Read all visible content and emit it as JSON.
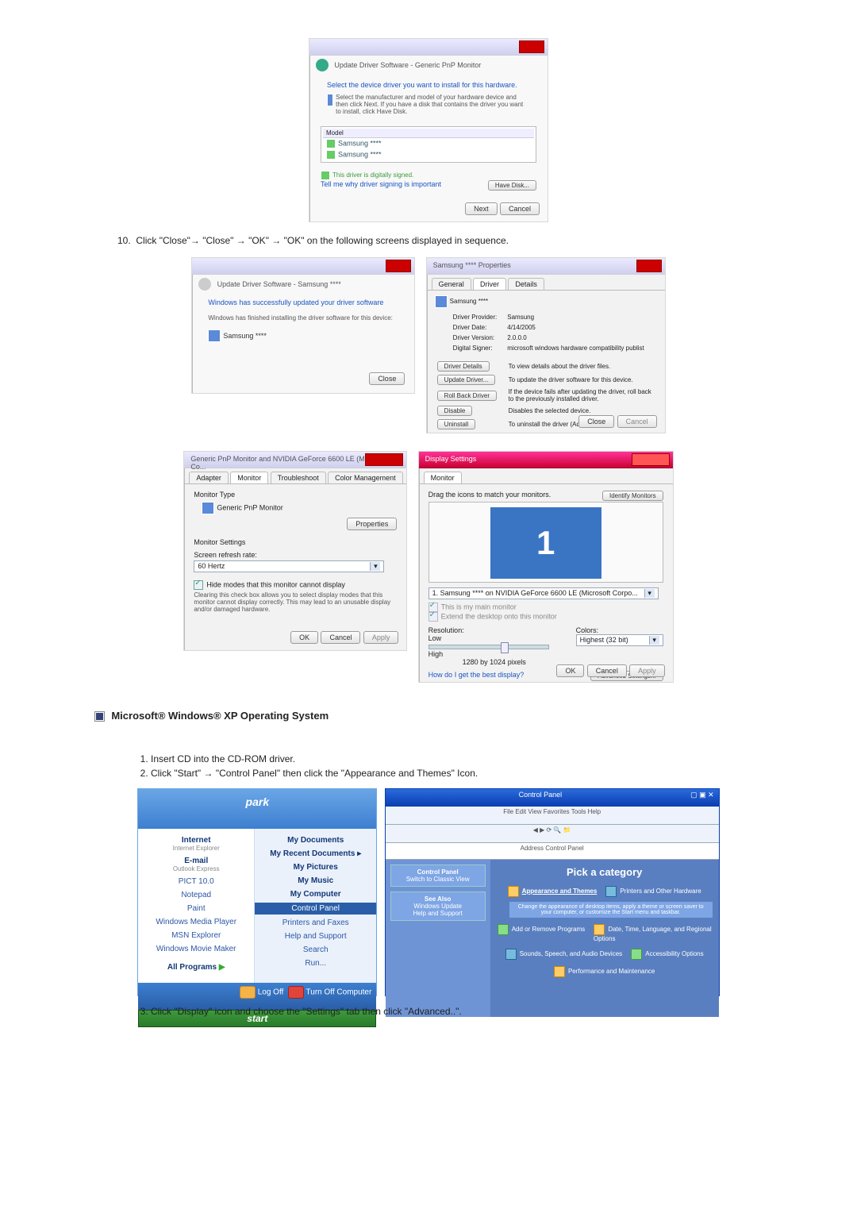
{
  "fig1": {
    "breadcrumb": "Update Driver Software - Generic PnP Monitor",
    "heading": "Select the device driver you want to install for this hardware.",
    "note": "Select the manufacturer and model of your hardware device and then click Next. If you have a disk that contains the driver you want to install, click Have Disk.",
    "model_h": "Model",
    "m1": "Samsung ****",
    "m2": "Samsung ****",
    "signed": "This driver is digitally signed.",
    "tell": "Tell me why driver signing is important",
    "have_disk": "Have Disk...",
    "next": "Next",
    "cancel": "Cancel"
  },
  "step10": "Click \"Close\"→ \"Close\" → \"OK\" → \"OK\" on the following screens displayed in sequence.",
  "upd": {
    "bc": "Update Driver Software - Samsung ****",
    "line1": "Windows has successfully updated your driver software",
    "line2": "Windows has finished installing the driver software for this device:",
    "dev": "Samsung ****",
    "close": "Close"
  },
  "prop": {
    "title": "Samsung **** Properties",
    "tab_g": "General",
    "tab_d": "Driver",
    "tab_de": "Details",
    "dev": "Samsung ****",
    "dp_l": "Driver Provider:",
    "dp_v": "Samsung",
    "dd_l": "Driver Date:",
    "dd_v": "4/14/2005",
    "dv_l": "Driver Version:",
    "dv_v": "2.0.0.0",
    "ds_l": "Digital Signer:",
    "ds_v": "microsoft windows hardware compatibility publist",
    "b1": "Driver Details",
    "b1d": "To view details about the driver files.",
    "b2": "Update Driver...",
    "b2d": "To update the driver software for this device.",
    "b3": "Roll Back Driver",
    "b3d": "If the device fails after updating the driver, roll back to the previously installed driver.",
    "b4": "Disable",
    "b4d": "Disables the selected device.",
    "b5": "Uninstall",
    "b5d": "To uninstall the driver (Advanced).",
    "close": "Close",
    "cancel": "Cancel"
  },
  "mon": {
    "title": "Generic PnP Monitor and NVIDIA GeForce 6600 LE (Microsoft Co...",
    "t1": "Adapter",
    "t2": "Monitor",
    "t3": "Troubleshoot",
    "t4": "Color Management",
    "mt": "Monitor Type",
    "mtv": "Generic PnP Monitor",
    "propbtn": "Properties",
    "ms": "Monitor Settings",
    "srr": "Screen refresh rate:",
    "srv": "60 Hertz",
    "chk": "Hide modes that this monitor cannot display",
    "warn": "Clearing this check box allows you to select display modes that this monitor cannot display correctly. This may lead to an unusable display and/or damaged hardware.",
    "ok": "OK",
    "cancel": "Cancel",
    "apply": "Apply"
  },
  "ds": {
    "title": "Display Settings",
    "tab": "Monitor",
    "drag": "Drag the icons to match your monitors.",
    "ident": "Identify Monitors",
    "num": "1",
    "sel": "1. Samsung **** on NVIDIA GeForce 6600 LE (Microsoft Corpo...",
    "c1": "This is my main monitor",
    "c2": "Extend the desktop onto this monitor",
    "res": "Resolution:",
    "low": "Low",
    "high": "High",
    "resv": "1280 by 1024 pixels",
    "col": "Colors:",
    "colv": "Highest (32 bit)",
    "how": "How do I get the best display?",
    "adv": "Advanced Settings...",
    "ok": "OK",
    "cancel": "Cancel",
    "apply": "Apply"
  },
  "xp_heading": "Microsoft® Windows® XP Operating System",
  "xp_steps": {
    "s1": "Insert CD into the CD-ROM driver.",
    "s2": "Click \"Start\" → \"Control Panel\" then click the \"Appearance and Themes\" Icon.",
    "s3": "Click \"Display\" icon and choose the \"Settings\" tab then click \"Advanced..\"."
  },
  "start": {
    "user": "park",
    "l": {
      "i1": "Internet",
      "i1s": "Internet Explorer",
      "i2": "E-mail",
      "i2s": "Outlook Express",
      "i3": "PICT 10.0",
      "i4": "Notepad",
      "i5": "Paint",
      "i6": "Windows Media Player",
      "i7": "MSN Explorer",
      "i8": "Windows Movie Maker",
      "all": "All Programs"
    },
    "r": {
      "r1": "My Documents",
      "r2": "My Recent Documents",
      "r3": "My Pictures",
      "r4": "My Music",
      "r5": "My Computer",
      "r6": "Control Panel",
      "r7": "Printers and Faxes",
      "r8": "Help and Support",
      "r9": "Search",
      "r10": "Run..."
    },
    "logoff": "Log Off",
    "turnoff": "Turn Off Computer",
    "startbtn": "start"
  },
  "cp": {
    "title": "Control Panel",
    "menu": "File  Edit  View  Favorites  Tools  Help",
    "addr": "Address    Control Panel",
    "side1": "Control Panel",
    "side1a": "Switch to Classic View",
    "side2": "See Also",
    "side2a": "Windows Update",
    "side2b": "Help and Support",
    "pick": "Pick a category",
    "c1": "Appearance and Themes",
    "c1d": "Printers and Other Hardware",
    "c2": "Change the appearance of desktop items, apply a theme or screen saver to your computer, or customize the Start menu and taskbar.",
    "c3": "Add or Remove Programs",
    "c3d": "Date, Time, Language, and Regional Options",
    "c4": "Sounds, Speech, and Audio Devices",
    "c4d": "Accessibility Options",
    "c5": "Performance and Maintenance"
  }
}
